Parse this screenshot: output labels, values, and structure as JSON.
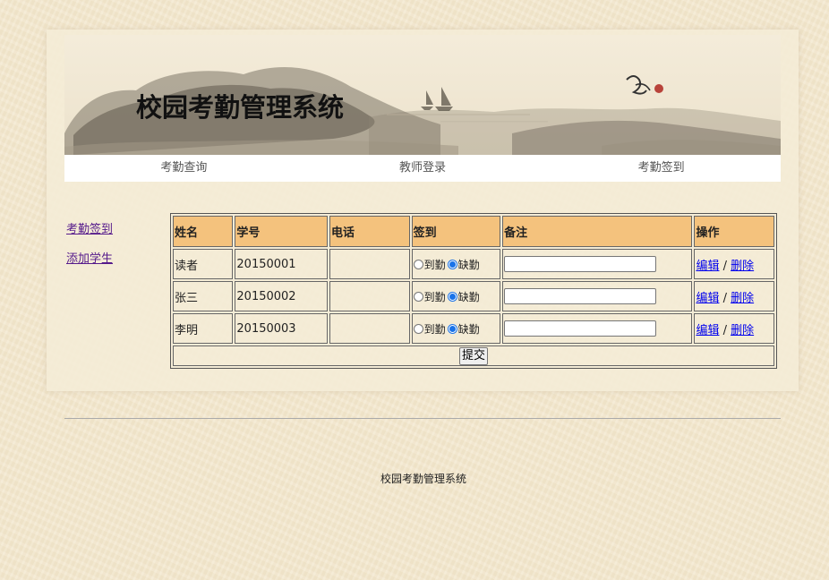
{
  "header": {
    "title": "校园考勤管理系统"
  },
  "nav": {
    "items": [
      {
        "label": "考勤查询"
      },
      {
        "label": "教师登录"
      },
      {
        "label": "考勤签到"
      }
    ]
  },
  "sidebar": {
    "items": [
      {
        "label": "考勤签到"
      },
      {
        "label": "添加学生"
      }
    ]
  },
  "table": {
    "headers": [
      "姓名",
      "学号",
      "电话",
      "签到",
      "备注",
      "操作"
    ],
    "radio_present": "到勤",
    "radio_absent": "缺勤",
    "edit_label": "编辑",
    "separator": " / ",
    "delete_label": "删除",
    "rows": [
      {
        "name": "读者",
        "student_id": "20150001",
        "phone": "",
        "status": "缺勤",
        "note": ""
      },
      {
        "name": "张三",
        "student_id": "20150002",
        "phone": "",
        "status": "缺勤",
        "note": ""
      },
      {
        "name": "李明",
        "student_id": "20150003",
        "phone": "",
        "status": "缺勤",
        "note": ""
      }
    ],
    "submit_label": "提交"
  },
  "footer": {
    "text": "校园考勤管理系统"
  },
  "colors": {
    "background": "#f3e8cf",
    "header_cell": "#f4c27d",
    "link": "#0000ee",
    "visited_link": "#551a8b",
    "radio_selected": "#1a73e8"
  }
}
